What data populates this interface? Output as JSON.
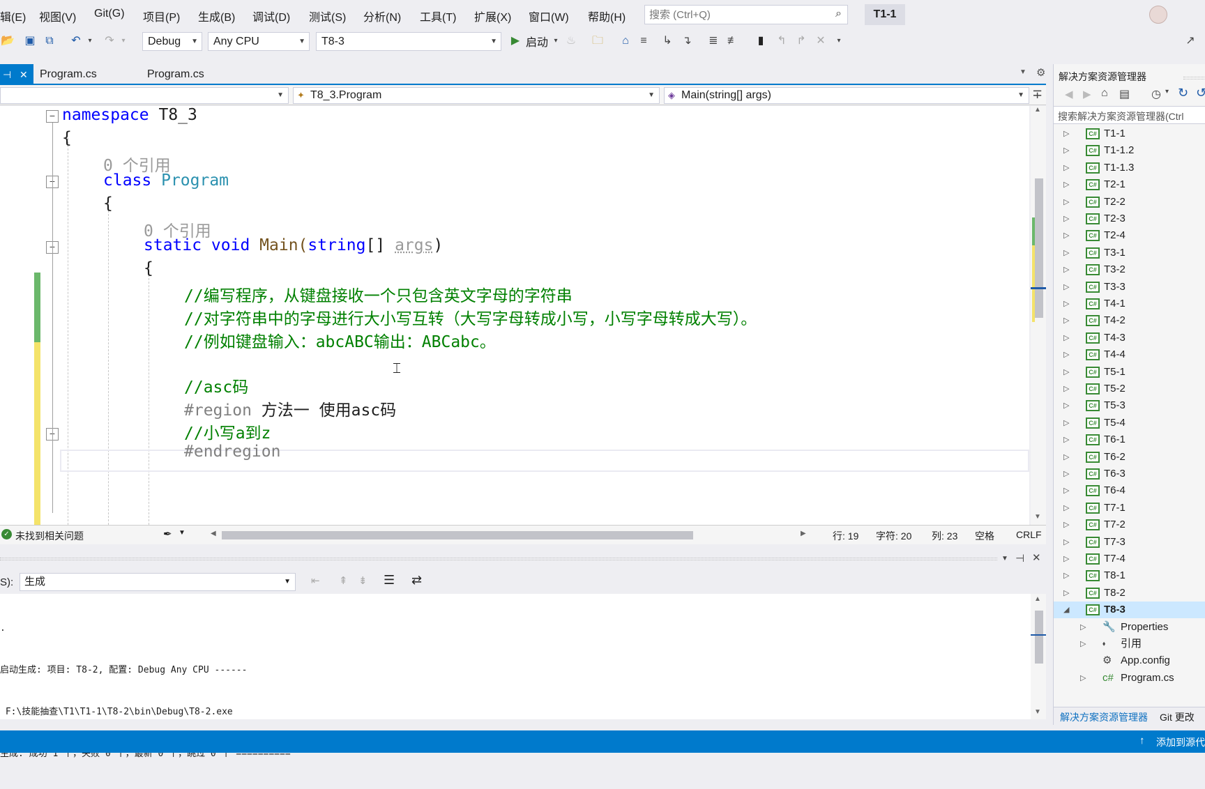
{
  "menu": [
    "辑(E)",
    "视图(V)",
    "Git(G)",
    "项目(P)",
    "生成(B)",
    "调试(D)",
    "测试(S)",
    "分析(N)",
    "工具(T)",
    "扩展(X)",
    "窗口(W)",
    "帮助(H)"
  ],
  "search": {
    "placeholder": "搜索 (Ctrl+Q)"
  },
  "solution_name": "T1-1",
  "toolbar": {
    "config": "Debug",
    "platform": "Any CPU",
    "startup_project": "T8-3",
    "start_label": "启动"
  },
  "tabs": {
    "pinned": "⊣ ✕",
    "tab1": "Program.cs",
    "tab2": "Program.cs"
  },
  "navbar": {
    "project": "",
    "class": "T8_3.Program",
    "member": "Main(string[] args)"
  },
  "code": {
    "l1_kw": "namespace",
    "l1_name": " T8_3",
    "l2": "{",
    "lens1": "0 个引用",
    "l3_kw": "class",
    "l3_ty": " Program",
    "l4": "{",
    "lens2": "0 个引用",
    "l5_a": "static void ",
    "l5_b": "Main(",
    "l5_c": "string",
    "l5_d": "[] ",
    "l5_e": "args",
    "l5_f": ")",
    "l6": "{",
    "c1": "//编写程序，从键盘接收一个只包含英文字母的字符串",
    "c2": "//对字符串中的字母进行大小写互转（大写字母转成小写，小写字母转成大写）。",
    "c3": "//例如键盘输入：abcABC输出：ABCabc。",
    "c4": "//asc码",
    "r1_kw": "#region",
    "r1_txt": " 方法一 使用asc码",
    "c5": "//小写a到z",
    "r2_kw": "#endregion"
  },
  "editor_status": {
    "issues": "未找到相关问题",
    "line": "行: 19",
    "char": "字符: 20",
    "col": "列: 23",
    "ws": "空格",
    "eol": "CRLF"
  },
  "output": {
    "source_label": "S):",
    "source_value": "生成",
    "lines": [
      ".",
      "启动生成: 项目: T8-2, 配置: Debug Any CPU ------",
      " F:\\技能抽查\\T1\\T1-1\\T8-2\\bin\\Debug\\T8-2.exe",
      "生成: 成功 1 个，失败 0 个，最新 0 个，跳过 0 个 =========="
    ]
  },
  "solution_explorer": {
    "title": "解决方案资源管理器",
    "search_placeholder": "搜索解决方案资源管理器(Ctrl",
    "projects": [
      "T1-1",
      "T1-1.2",
      "T1-1.3",
      "T2-1",
      "T2-2",
      "T2-3",
      "T2-4",
      "T3-1",
      "T3-2",
      "T3-3",
      "T4-1",
      "T4-2",
      "T4-3",
      "T4-4",
      "T5-1",
      "T5-2",
      "T5-3",
      "T5-4",
      "T6-1",
      "T6-2",
      "T6-3",
      "T6-4",
      "T7-1",
      "T7-2",
      "T7-3",
      "T7-4",
      "T8-1",
      "T8-2"
    ],
    "expanded_project": "T8-3",
    "children": [
      "Properties",
      "引用",
      "App.config",
      "Program.cs"
    ],
    "bottom_tabs": [
      "解决方案资源管理器",
      "Git 更改"
    ]
  },
  "status_bar": {
    "right": "添加到源代"
  }
}
